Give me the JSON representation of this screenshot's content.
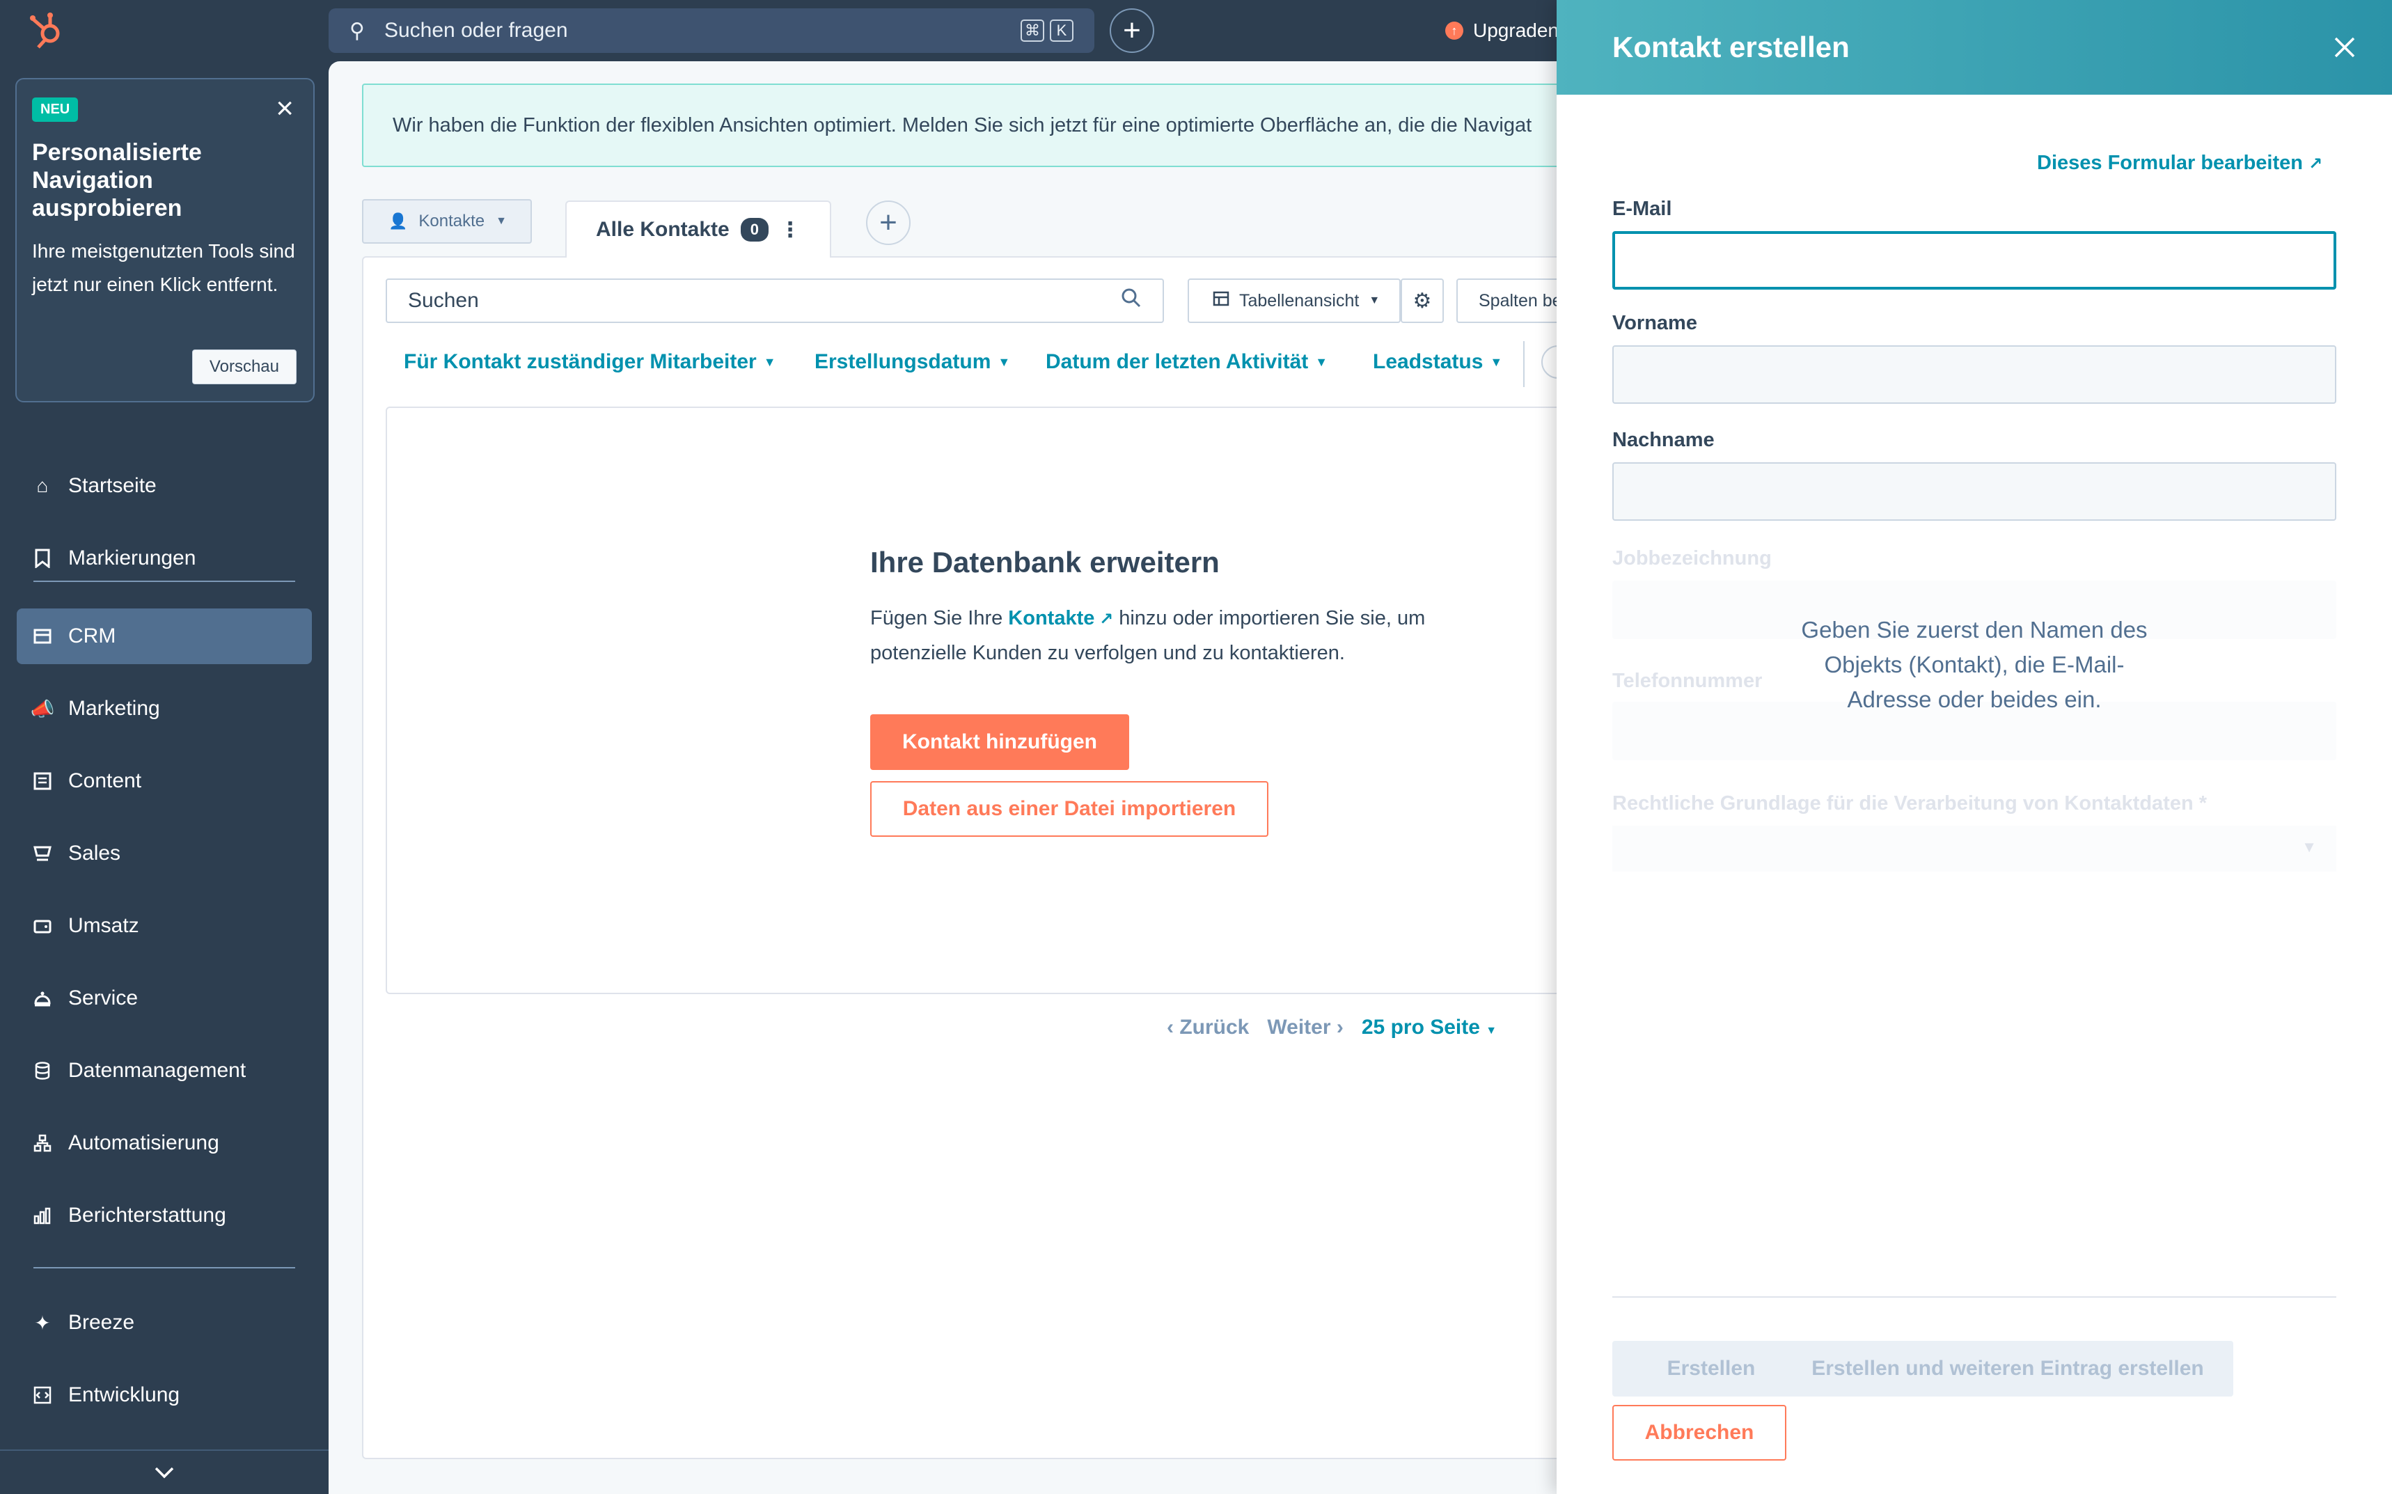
{
  "topbar": {
    "search_placeholder": "Suchen oder fragen",
    "kbd_cmd": "⌘",
    "kbd_k": "K",
    "upgrade_label": "Upgraden"
  },
  "promo": {
    "badge": "NEU",
    "title": "Personalisierte Navigation ausprobieren",
    "text": "Ihre meistgenutzten Tools sind jetzt nur einen Klick entfernt.",
    "button": "Vorschau"
  },
  "sidebar": {
    "items": [
      {
        "label": "Startseite",
        "icon": "home-icon"
      },
      {
        "label": "Markierungen",
        "icon": "bookmark-icon"
      },
      {
        "label": "CRM",
        "icon": "crm-icon",
        "active": true
      },
      {
        "label": "Marketing",
        "icon": "megaphone-icon"
      },
      {
        "label": "Content",
        "icon": "content-icon"
      },
      {
        "label": "Sales",
        "icon": "sales-icon"
      },
      {
        "label": "Umsatz",
        "icon": "wallet-icon"
      },
      {
        "label": "Service",
        "icon": "service-icon"
      },
      {
        "label": "Datenmanagement",
        "icon": "database-icon"
      },
      {
        "label": "Automatisierung",
        "icon": "workflow-icon"
      },
      {
        "label": "Berichterstattung",
        "icon": "chart-icon"
      },
      {
        "label": "Breeze",
        "icon": "sparkle-icon"
      },
      {
        "label": "Entwicklung",
        "icon": "code-icon"
      }
    ]
  },
  "main": {
    "notice": "Wir haben die Funktion der flexiblen Ansichten optimiert. Melden Sie sich jetzt für eine optimierte Oberfläche an, die die Navigat",
    "object_selector": "Kontakte",
    "view_tab": {
      "label": "Alle Kontakte",
      "count": "0"
    },
    "table_search_placeholder": "Suchen",
    "table_view_label": "Tabellenansicht",
    "columns_label": "Spalten be",
    "filters": [
      "Für Kontakt zuständiger Mitarbeiter",
      "Erstellungsdatum",
      "Datum der letzten Aktivität",
      "Leadstatus"
    ],
    "empty": {
      "title": "Ihre Datenbank erweitern",
      "text_before": "Fügen Sie Ihre ",
      "text_link": "Kontakte",
      "text_after": " hinzu oder importieren Sie sie, um potenzielle Kunden zu verfolgen und zu kontaktieren.",
      "add_button": "Kontakt hinzufügen",
      "import_button": "Daten aus einer Datei importieren"
    },
    "pager": {
      "prev": "Zurück",
      "next": "Weiter",
      "per_page": "25 pro Seite"
    }
  },
  "modal": {
    "title": "Kontakt erstellen",
    "edit_form_link": "Dieses Formular bearbeiten",
    "fields": {
      "email": "E-Mail",
      "firstname": "Vorname",
      "lastname": "Nachname",
      "jobtitle": "Jobbezeichnung",
      "phone": "Telefonnummer",
      "legal": "Rechtliche Grundlage für die Verarbeitung von Kontaktdaten *"
    },
    "hint": "Geben Sie zuerst den Namen des Objekts (Kontakt), die E-Mail-Adresse oder beides ein.",
    "buttons": {
      "create": "Erstellen",
      "create_more": "Erstellen und weiteren Eintrag erstellen",
      "cancel": "Abbrechen"
    }
  },
  "colors": {
    "sidebar_bg": "#2d3e50",
    "accent_orange": "#ff7a59",
    "link_teal": "#0091ae",
    "modal_header": "#4fb3bf"
  }
}
